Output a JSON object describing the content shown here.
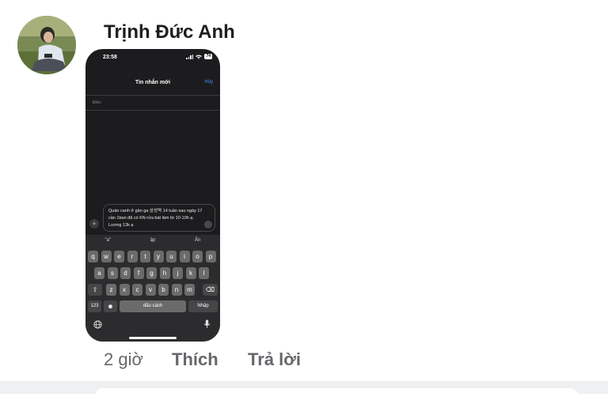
{
  "comment": {
    "author": "Trịnh Đức Anh",
    "time": "2 giờ",
    "like_label": "Thích",
    "reply_label": "Trả lời"
  },
  "phone": {
    "status_time": "23:58",
    "battery": "74",
    "nav_title": "Tin nhắn mới",
    "cancel_label": "Hủy",
    "to_label": "Đến:",
    "message": "Quán canh ở gần ga 삼성역 14 tuần sau ngày 17 cần 1ban đã có KN rửa bát làm từ 10-10h ạ. Lương 13k ạ",
    "suggestions": [
      "\"a\"",
      "ập",
      "Ấn"
    ],
    "keyboard": {
      "row1": [
        "q",
        "w",
        "e",
        "r",
        "t",
        "y",
        "u",
        "i",
        "o",
        "p"
      ],
      "row2": [
        "a",
        "s",
        "d",
        "f",
        "g",
        "h",
        "j",
        "k",
        "l"
      ],
      "row3": [
        "z",
        "x",
        "c",
        "v",
        "b",
        "n",
        "m"
      ],
      "num_label": "123",
      "space_label": "dấu cách",
      "return_label": "Nhập"
    }
  }
}
